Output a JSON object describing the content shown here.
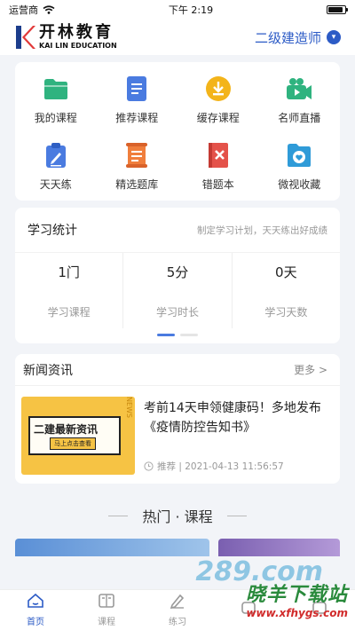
{
  "status_bar": {
    "carrier": "运营商",
    "time": "下午 2:19",
    "battery_level": 0.9
  },
  "header": {
    "logo_cn": "开林教育",
    "logo_en": "KAI LIN EDUCATION",
    "level": "二级建造师"
  },
  "grid": [
    {
      "label": "我的课程",
      "icon": "folder-icon",
      "color": "#2fb37f"
    },
    {
      "label": "推荐课程",
      "icon": "document-icon",
      "color": "#4a7be0"
    },
    {
      "label": "缓存课程",
      "icon": "download-icon",
      "color": "#f3b41a"
    },
    {
      "label": "名师直播",
      "icon": "video-camera-icon",
      "color": "#2fb37f"
    },
    {
      "label": "天天练",
      "icon": "clipboard-pen-icon",
      "color": "#4a7be0"
    },
    {
      "label": "精选题库",
      "icon": "scroll-list-icon",
      "color": "#f07e3c"
    },
    {
      "label": "错题本",
      "icon": "wrong-book-icon",
      "color": "#e4524a"
    },
    {
      "label": "微视收藏",
      "icon": "favorite-folder-icon",
      "color": "#2f9bd8"
    }
  ],
  "stats": {
    "title": "学习统计",
    "subtitle": "制定学习计划，天天练出好成绩",
    "items": [
      {
        "value": "1门",
        "label": "学习课程"
      },
      {
        "value": "5分",
        "label": "学习时长"
      },
      {
        "value": "0天",
        "label": "学习天数"
      }
    ],
    "page_count": 2,
    "active_page": 1
  },
  "news": {
    "title": "新闻资讯",
    "more": "更多 >",
    "item": {
      "thumb_title": "二建最新资讯",
      "thumb_button": "马上点击查看",
      "thumb_side": "NEWS",
      "headline": "考前14天申领健康码！多地发布《疫情防控告知书》",
      "meta": "推荐 | 2021-04-13 11:56:57"
    }
  },
  "section_title": "热门 · 课程",
  "tabs": [
    {
      "label": "首页",
      "icon": "home-icon",
      "active": true
    },
    {
      "label": "课程",
      "icon": "book-icon",
      "active": false
    },
    {
      "label": "练习",
      "icon": "pencil-icon",
      "active": false
    },
    {
      "label": "",
      "icon": "unknown-icon",
      "active": false
    },
    {
      "label": "",
      "icon": "unknown-icon",
      "active": false
    }
  ],
  "watermark": {
    "number": "289.com",
    "text": "晓羊下载站",
    "url": "www.xfhygs.com"
  },
  "colors": {
    "accent": "#2c5bc6",
    "indicator": "#4a7be0"
  }
}
